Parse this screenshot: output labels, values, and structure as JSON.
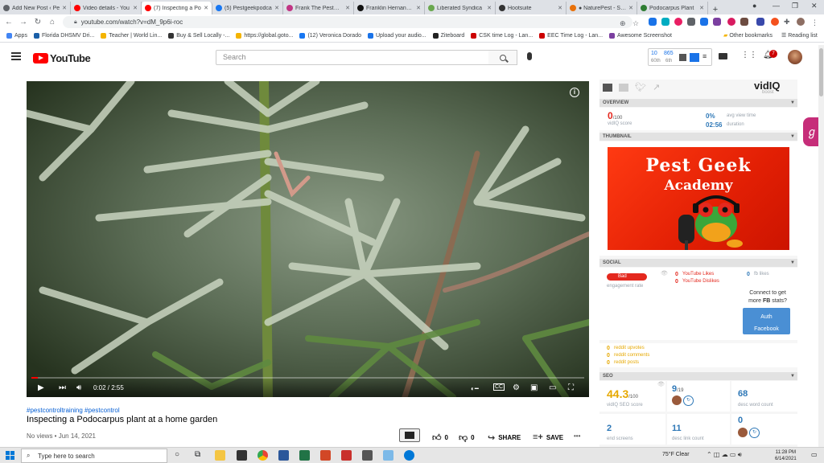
{
  "browser": {
    "tabs": [
      {
        "label": "Add New Post ‹ Pe",
        "color": "#5f6368",
        "active": false
      },
      {
        "label": "Video details - You",
        "color": "#ff0000",
        "active": false
      },
      {
        "label": "(7) Inspecting a Po",
        "color": "#ff0000",
        "active": true
      },
      {
        "label": "(5) Pestgeekpodca",
        "color": "#1877f2",
        "active": false
      },
      {
        "label": "Frank The PestGee",
        "color": "#c13584",
        "active": false
      },
      {
        "label": "Franklin Hernandez",
        "color": "#111111",
        "active": false
      },
      {
        "label": "Liberated Syndica",
        "color": "#6aa84f",
        "active": false
      },
      {
        "label": "Hootsuite",
        "color": "#333333",
        "active": false
      },
      {
        "label": "● NaturePest - SEO",
        "color": "#e8710a",
        "active": false
      },
      {
        "label": "Podocarpus Plant",
        "color": "#2e7d32",
        "active": false
      }
    ],
    "new_tab": "+",
    "url": "youtube.com/watch?v=dM_9p6i-roc",
    "bookmarks": [
      {
        "label": "Apps",
        "color": "#4285f4"
      },
      {
        "label": "Florida DHSMV Dri...",
        "color": "#1a5fa8"
      },
      {
        "label": "Teacher | World Lin...",
        "color": "#f4b400"
      },
      {
        "label": "Buy & Sell Locally -...",
        "color": "#333333"
      },
      {
        "label": "https://global.goto...",
        "color": "#f4b400"
      },
      {
        "label": "(12) Veronica Dorado",
        "color": "#1877f2"
      },
      {
        "label": "Upload your audio...",
        "color": "#1a73e8"
      },
      {
        "label": "Ziteboard",
        "color": "#222222"
      },
      {
        "label": "CSK time Log - Lan...",
        "color": "#cc0000"
      },
      {
        "label": "EEC Time Log - Lan...",
        "color": "#cc0000"
      },
      {
        "label": "Awesome Screenshot",
        "color": "#7b3fa0"
      }
    ],
    "other_bookmarks": "Other bookmarks",
    "reading_list": "Reading list"
  },
  "youtube": {
    "logo_text": "YouTube",
    "search_placeholder": "Search",
    "vidiq_top": {
      "a": "10",
      "a_sub": "60th",
      "b": "865",
      "b_sub": "6th"
    },
    "notif_count": "7",
    "player": {
      "time": "0:02 / 2:55",
      "progress": 0.011
    },
    "hashtags": "#pestcontroltraining #pestcontrol",
    "title": "Inspecting a Podocarpus plant at a home garden",
    "meta": "No views • Jun 14, 2021",
    "likes": "0",
    "dislikes": "0",
    "share": "SHARE",
    "save": "SAVE",
    "more": "•••"
  },
  "vidiq": {
    "brand": "vidIQ",
    "brand_sub": "boost",
    "overview_title": "OVERVIEW",
    "score": "0",
    "score_max": "/100",
    "score_label": "vidIQ score",
    "avg_view": "0%",
    "avg_view_label": "avg view time",
    "duration": "02:56",
    "duration_label": "duration",
    "thumbnail_title": "THUMBNAIL",
    "thumb_line1": "Pest Geek",
    "thumb_line2": "Academy",
    "social_title": "SOCIAL",
    "engagement_badge": "Bad",
    "engagement_label": "engagement rate",
    "yt_likes": "0",
    "yt_likes_label": "YouTube Likes",
    "yt_dislikes": "0",
    "yt_dislikes_label": "YouTube Dislikes",
    "fb_likes": "0",
    "fb_likes_label": "fb likes",
    "fb_connect": "Connect to get more FB stats?",
    "fb_connect_a": "Connect to get",
    "fb_connect_b": "more ",
    "fb_connect_fb": "FB",
    "fb_connect_c": " stats?",
    "auth_l1": "Auth",
    "auth_l2": "Facebook",
    "reddit_upvotes": "0",
    "reddit_upvotes_label": "reddit upvotes",
    "reddit_comments": "0",
    "reddit_comments_label": "reddit comments",
    "reddit_posts": "0",
    "reddit_posts_label": "reddit posts",
    "seo_title": "SEO",
    "seo_score": "44.3",
    "seo_max": "/100",
    "seo_label": "vidIQ SEO score",
    "tags_used": "9",
    "tags_max": "/19",
    "word_count": "68",
    "word_count_label": "desc word count",
    "end_screens": "2",
    "end_screens_label": "end screens",
    "link_count": "11",
    "link_count_label": "desc link count",
    "cards": "0"
  },
  "taskbar": {
    "search_placeholder": "Type here to search",
    "weather": "75°F  Clear",
    "time": "11:28 PM",
    "date": "6/14/2021"
  }
}
